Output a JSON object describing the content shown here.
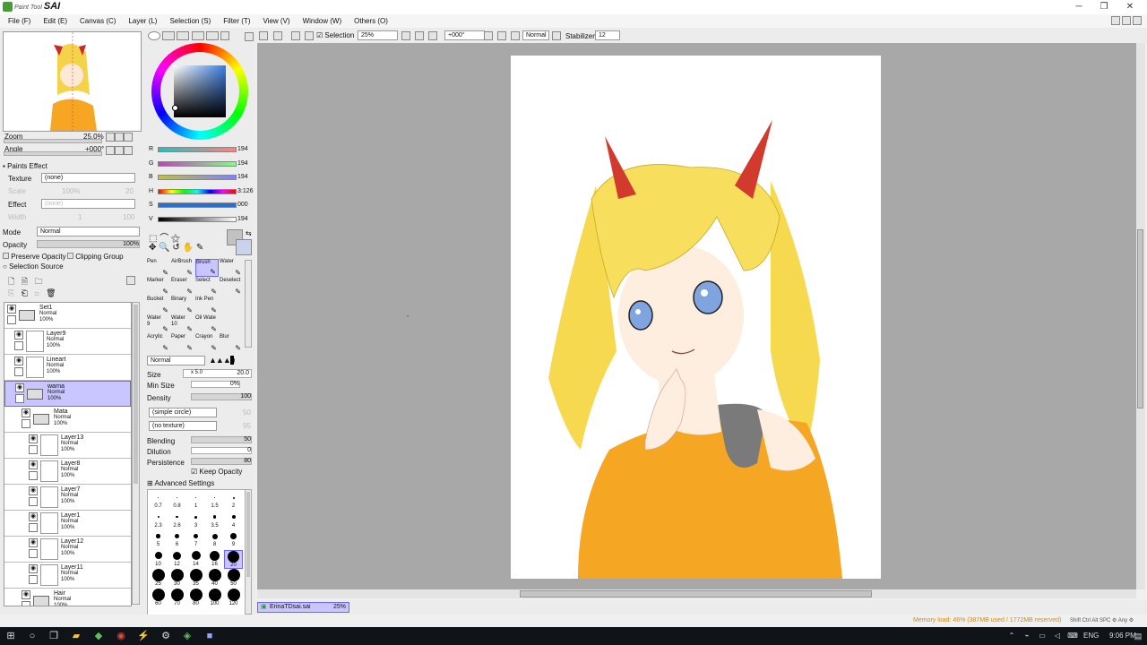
{
  "app": {
    "brand_small": "Paint Tool",
    "brand": "SAI"
  },
  "window_controls": {
    "minimize": "─",
    "maximize": "❐",
    "close": "✕"
  },
  "menu": [
    "File (F)",
    "Edit (E)",
    "Canvas (C)",
    "Layer (L)",
    "Selection (S)",
    "Filter (T)",
    "View (V)",
    "Window (W)",
    "Others (O)"
  ],
  "navigator": {
    "zoom_label": "Zoom",
    "zoom_value": "25.0%",
    "angle_label": "Angle",
    "angle_value": "+000°"
  },
  "paints_effect": {
    "header": "Paints Effect",
    "texture_label": "Texture",
    "texture_value": "(none)",
    "scale_label": "Scale",
    "scale_value": "100%",
    "scale_num": "20",
    "effect_label": "Effect",
    "effect_value": "(none)",
    "width_label": "Width",
    "width_num1": "1",
    "width_num2": "100"
  },
  "layer_props": {
    "mode_label": "Mode",
    "mode_value": "Normal",
    "opacity_label": "Opacity",
    "opacity_value": "100%",
    "preserve_opacity": "Preserve Opacity",
    "clipping_group": "Clipping Group",
    "selection_source": "Selection Source"
  },
  "layers": [
    {
      "name": "Set1",
      "mode": "Normal",
      "opacity": "100%",
      "type": "folder",
      "indent": 0
    },
    {
      "name": "Layer9",
      "mode": "Normal",
      "opacity": "100%",
      "type": "layer",
      "indent": 1
    },
    {
      "name": "Lineart",
      "mode": "Normal",
      "opacity": "100%",
      "type": "layer",
      "indent": 1
    },
    {
      "name": "warna",
      "mode": "Normal",
      "opacity": "100%",
      "type": "folder",
      "indent": 1,
      "selected": true
    },
    {
      "name": "Mata",
      "mode": "Normal",
      "opacity": "100%",
      "type": "folder",
      "indent": 2
    },
    {
      "name": "Layer13",
      "mode": "Normal",
      "opacity": "100%",
      "type": "layer",
      "indent": 3
    },
    {
      "name": "Layer8",
      "mode": "Normal",
      "opacity": "100%",
      "type": "layer",
      "indent": 3
    },
    {
      "name": "Layer7",
      "mode": "Normal",
      "opacity": "100%",
      "type": "layer",
      "indent": 3
    },
    {
      "name": "Layer1",
      "mode": "Normal",
      "opacity": "100%",
      "type": "layer",
      "indent": 3
    },
    {
      "name": "Layer12",
      "mode": "Normal",
      "opacity": "100%",
      "type": "layer",
      "indent": 3
    },
    {
      "name": "Layer11",
      "mode": "Normal",
      "opacity": "100%",
      "type": "layer",
      "indent": 3
    },
    {
      "name": "Hair",
      "mode": "Normal",
      "opacity": "100%",
      "type": "folder",
      "indent": 2
    }
  ],
  "color_sliders": [
    {
      "label": "R",
      "value": "194"
    },
    {
      "label": "G",
      "value": "194"
    },
    {
      "label": "B",
      "value": "194"
    },
    {
      "label": "H",
      "value": "3:126"
    },
    {
      "label": "S",
      "value": "000"
    },
    {
      "label": "V",
      "value": "194"
    }
  ],
  "tools": [
    {
      "name": "Pen",
      "sub": ""
    },
    {
      "name": "AirBrush",
      "sub": ""
    },
    {
      "name": "Brush",
      "sub": "",
      "selected": true
    },
    {
      "name": "Water",
      "sub": ""
    },
    {
      "name": "Marker",
      "sub": ""
    },
    {
      "name": "Eraser",
      "sub": ""
    },
    {
      "name": "Select",
      "sub": ""
    },
    {
      "name": "Deselect",
      "sub": ""
    },
    {
      "name": "Bucket",
      "sub": ""
    },
    {
      "name": "Binary",
      "sub": ""
    },
    {
      "name": "Ink Pen",
      "sub": ""
    },
    {
      "name": "",
      "sub": ""
    },
    {
      "name": "Water",
      "sub": "9"
    },
    {
      "name": "Water",
      "sub": "10"
    },
    {
      "name": "Oil Wate",
      "sub": ""
    },
    {
      "name": "",
      "sub": ""
    },
    {
      "name": "Acrylic",
      "sub": ""
    },
    {
      "name": "Paper",
      "sub": ""
    },
    {
      "name": "Crayon",
      "sub": ""
    },
    {
      "name": "Blur",
      "sub": ""
    }
  ],
  "brush": {
    "blend_mode": "Normal",
    "size_label": "Size",
    "size_mult": "x 5.0",
    "size_value": "20.0",
    "min_size_label": "Min Size",
    "min_size_value": "0%",
    "density_label": "Density",
    "density_value": "100",
    "shape": "(simple circle)",
    "shape_num": "50",
    "texture": "(no texture)",
    "texture_num": "95",
    "blending_label": "Blending",
    "blending_value": "50",
    "dilution_label": "Dilution",
    "dilution_value": "0",
    "persistence_label": "Persistence",
    "persistence_value": "80",
    "keep_opacity": "Keep Opacity",
    "advanced": "Advanced Settings"
  },
  "brush_sizes": [
    "0.7",
    "0.8",
    "1",
    "1.5",
    "2",
    "2.3",
    "2.6",
    "3",
    "3.5",
    "4",
    "5",
    "6",
    "7",
    "8",
    "9",
    "10",
    "12",
    "14",
    "16",
    "20",
    "25",
    "30",
    "35",
    "40",
    "50",
    "60",
    "70",
    "80",
    "100",
    "120"
  ],
  "toolbar": {
    "selection_label": "Selection",
    "zoom_value": "25%",
    "angle_value": "+000°",
    "mode_value": "Normal",
    "stabilizer_label": "Stabilizer",
    "stabilizer_value": "12"
  },
  "document_tab": {
    "name": "ErinaTDsai.sai",
    "zoom": "25%"
  },
  "status": {
    "memory": "Memory load: 46% (387MB used / 1772MB reserved)",
    "keys": "Shift Ctrl Alt SPC ⚙ Any ⚙"
  },
  "taskbar": {
    "lang": "ENG",
    "time": "9:06 PM"
  },
  "colors": {
    "accent": "#6b66ff",
    "selected_bg": "#c9c6ff",
    "canvas_bg": "#a8a8a8",
    "memory_text": "#e08a00"
  }
}
